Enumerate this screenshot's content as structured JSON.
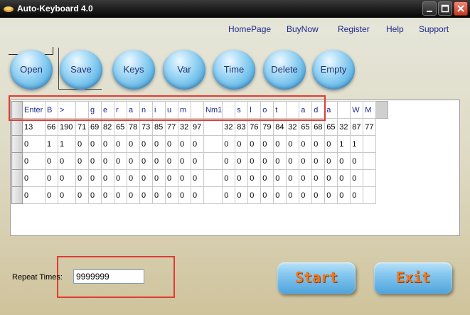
{
  "window": {
    "title": "Auto-Keyboard 4.0",
    "icon": "keyboard-app-icon"
  },
  "titlebar_buttons": [
    "minimize-icon",
    "maximize-icon",
    "close-icon"
  ],
  "links": [
    "HomePage",
    "BuyNow",
    "Register",
    "Help",
    "Support"
  ],
  "toolbar": [
    "Open",
    "Save",
    "Keys",
    "Var",
    "Time",
    "Delete",
    "Empty"
  ],
  "grid": {
    "header": [
      "Enter",
      "B",
      ">",
      "",
      "g",
      "e",
      "r",
      "a",
      "n",
      "i",
      "u",
      "m",
      "",
      "Nm1",
      "",
      "s",
      "l",
      "o",
      "t",
      "",
      "a",
      "d",
      "a",
      "",
      "W",
      "M"
    ],
    "rows": [
      [
        "13",
        "66",
        "190",
        "71",
        "69",
        "82",
        "65",
        "78",
        "73",
        "85",
        "77",
        "32",
        "97",
        "",
        "32",
        "83",
        "76",
        "79",
        "84",
        "32",
        "65",
        "68",
        "65",
        "32",
        "87",
        "77"
      ],
      [
        "0",
        "1",
        "1",
        "0",
        "0",
        "0",
        "0",
        "0",
        "0",
        "0",
        "0",
        "0",
        "0",
        "",
        "0",
        "0",
        "0",
        "0",
        "0",
        "0",
        "0",
        "0",
        "0",
        "1",
        "1",
        ""
      ],
      [
        "0",
        "0",
        "0",
        "0",
        "0",
        "0",
        "0",
        "0",
        "0",
        "0",
        "0",
        "0",
        "0",
        "",
        "0",
        "0",
        "0",
        "0",
        "0",
        "0",
        "0",
        "0",
        "0",
        "0",
        "0",
        ""
      ],
      [
        "0",
        "0",
        "0",
        "0",
        "0",
        "0",
        "0",
        "0",
        "0",
        "0",
        "0",
        "0",
        "0",
        "",
        "0",
        "0",
        "0",
        "0",
        "0",
        "0",
        "0",
        "0",
        "0",
        "0",
        "0",
        ""
      ],
      [
        "0",
        "0",
        "0",
        "0",
        "0",
        "0",
        "0",
        "0",
        "0",
        "0",
        "0",
        "0",
        "0",
        "",
        "0",
        "0",
        "0",
        "0",
        "0",
        "0",
        "0",
        "0",
        "0",
        "0",
        "0",
        ""
      ]
    ]
  },
  "repeat": {
    "label": "Repeat Times:",
    "value": "9999999"
  },
  "actions": {
    "start": "Start",
    "exit": "Exit"
  },
  "colors": {
    "link": "#1c2a8c",
    "highlight": "#e03b34",
    "action_text": "#f0781e",
    "button": "#6fbde9"
  }
}
